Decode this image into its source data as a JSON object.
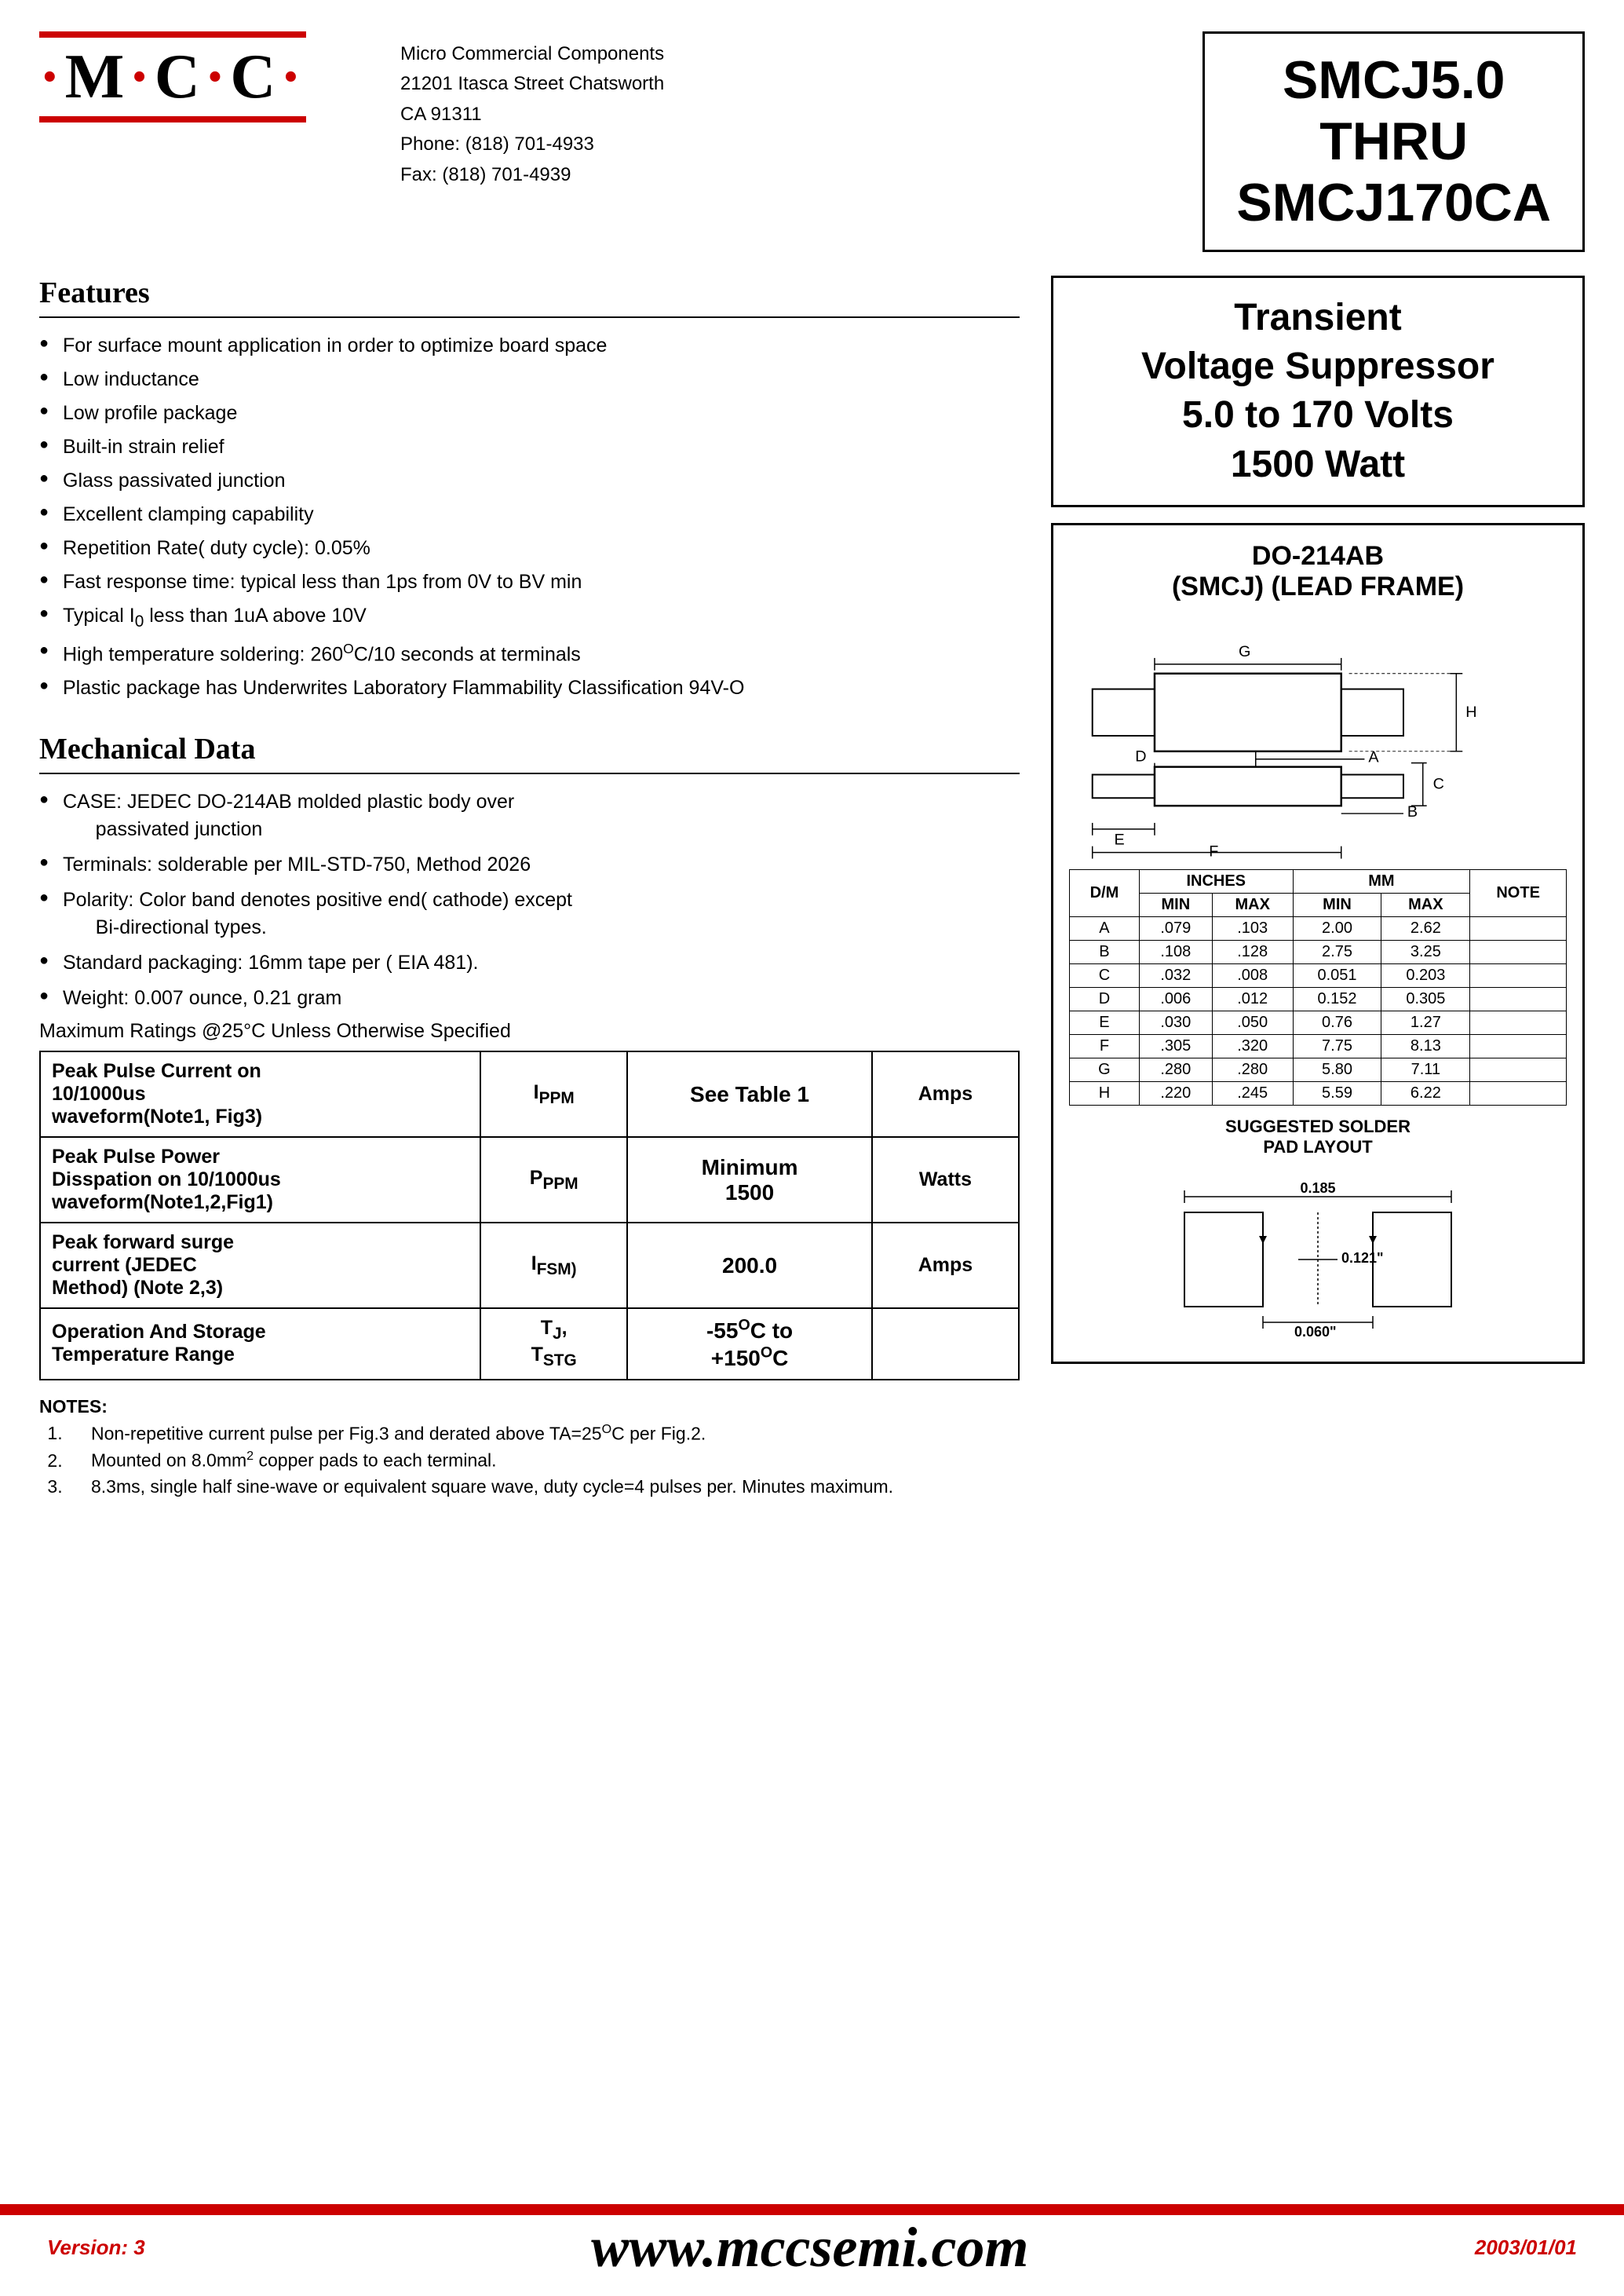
{
  "company": {
    "logo_text": "·M·C·C·",
    "name": "Micro Commercial Components",
    "address1": "21201 Itasca Street Chatsworth",
    "address2": "CA 91311",
    "phone": "Phone: (818) 701-4933",
    "fax": "Fax:    (818) 701-4939"
  },
  "part_number": {
    "title": "SMCJ5.0\nTHRU\nSMCJ170CA"
  },
  "tvs": {
    "line1": "Transient",
    "line2": "Voltage Suppressor",
    "line3": "5.0 to 170 Volts",
    "line4": "1500 Watt"
  },
  "package": {
    "title_line1": "DO-214AB",
    "title_line2": "(SMCJ) (LEAD FRAME)"
  },
  "features": {
    "title": "Features",
    "items": [
      "For surface mount application in order to optimize board space",
      "Low inductance",
      "Low profile package",
      "Built-in strain relief",
      "Glass passivated junction",
      "Excellent clamping capability",
      "Repetition Rate( duty cycle): 0.05%",
      "Fast response time: typical less than 1ps from 0V to BV min",
      "Typical I₀ less than 1uA above 10V",
      "High temperature soldering: 260°C/10 seconds at terminals",
      "Plastic package has Underwrites Laboratory Flammability Classification 94V-O"
    ]
  },
  "mechanical": {
    "title": "Mechanical Data",
    "items": [
      "CASE: JEDEC DO-214AB molded plastic body over passivated junction",
      "Terminals:  solderable per MIL-STD-750, Method 2026",
      "Polarity: Color band denotes positive end( cathode) except Bi-directional types.",
      "Standard packaging: 16mm tape per ( EIA 481).",
      "Weight: 0.007 ounce, 0.21 gram"
    ],
    "max_ratings_note": "Maximum Ratings @25°C Unless Otherwise Specified"
  },
  "ratings_table": {
    "rows": [
      {
        "label": "Peak Pulse Current on 10/1000us waveform(Note1, Fig3)",
        "symbol": "IPPM",
        "value": "See Table 1",
        "unit": "Amps"
      },
      {
        "label": "Peak Pulse Power Disspation on 10/1000us waveform(Note1,2,Fig1)",
        "symbol": "PPPM",
        "value": "Minimum\n1500",
        "unit": "Watts"
      },
      {
        "label": "Peak forward surge current (JEDEC Method) (Note 2,3)",
        "symbol": "IFSM)",
        "value": "200.0",
        "unit": "Amps"
      },
      {
        "label": "Operation And Storage Temperature Range",
        "symbol": "TJ,\nTSTG",
        "value": "-55°C to\n+150°C",
        "unit": ""
      }
    ]
  },
  "notes": {
    "title": "NOTES:",
    "items": [
      "Non-repetitive current pulse per Fig.3 and derated above TA=25°C per Fig.2.",
      "Mounted on 8.0mm² copper pads to each terminal.",
      "8.3ms, single half sine-wave or equivalent square wave, duty cycle=4 pulses per. Minutes maximum."
    ]
  },
  "dimensions_table": {
    "header_inches": "INCHES",
    "header_mm": "MM",
    "columns": [
      "D/M",
      "MIN",
      "MAX",
      "MIN",
      "MAX",
      "NOTE"
    ],
    "rows": [
      [
        "A",
        ".079",
        ".103",
        "2.00",
        "2.62",
        ""
      ],
      [
        "B",
        ".108",
        ".128",
        "2.75",
        "3.25",
        ""
      ],
      [
        "C",
        ".032",
        ".008",
        "0.051",
        "0.203",
        ""
      ],
      [
        "D",
        ".006",
        ".012",
        "0.152",
        "0.305",
        ""
      ],
      [
        "E",
        ".030",
        ".050",
        "0.76",
        "1.27",
        ""
      ],
      [
        "F",
        ".305",
        ".320",
        "7.75",
        "8.13",
        ""
      ],
      [
        "G",
        ".280",
        ".280",
        "5.80",
        "7.11",
        ""
      ],
      [
        "H",
        ".220",
        ".245",
        "5.59",
        "6.22",
        ""
      ]
    ]
  },
  "solder_pad": {
    "title": "SUGGESTED SOLDER\nPAD LAYOUT",
    "dim1": "0.185",
    "dim2": "0.121\"",
    "dim3": "0.060\""
  },
  "footer": {
    "url": "www.mccsemi.com",
    "version_label": "Version:",
    "version_value": "3",
    "date": "2003/01/01"
  }
}
